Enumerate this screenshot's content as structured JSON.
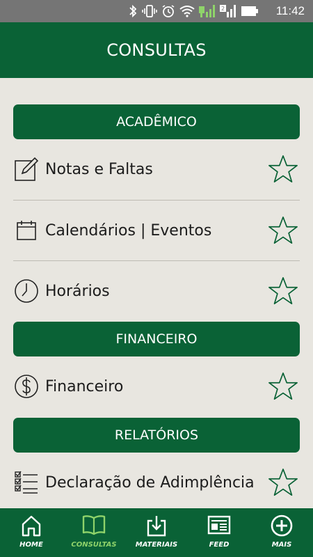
{
  "status_bar": {
    "time": "11:42",
    "icons": [
      "bluetooth-icon",
      "vibrate-icon",
      "alarm-icon",
      "wifi-icon",
      "signal-icon",
      "signal-2-icon",
      "battery-icon"
    ]
  },
  "header": {
    "title": "CONSULTAS"
  },
  "sections": [
    {
      "title": "ACADÊMICO",
      "items": [
        {
          "label": "Notas e Faltas",
          "icon": "edit-icon"
        },
        {
          "label": "Calendários | Eventos",
          "icon": "calendar-icon"
        },
        {
          "label": "Horários",
          "icon": "clock-icon"
        }
      ]
    },
    {
      "title": "FINANCEIRO",
      "items": [
        {
          "label": "Financeiro",
          "icon": "dollar-icon"
        }
      ]
    },
    {
      "title": "RELATÓRIOS",
      "items": [
        {
          "label": "Declaração de Adimplência",
          "icon": "checklist-icon"
        }
      ]
    }
  ],
  "bottom_nav": [
    {
      "label": "HOME",
      "icon": "home-icon",
      "active": false
    },
    {
      "label": "CONSULTAS",
      "icon": "book-icon",
      "active": true
    },
    {
      "label": "MATERIAIS",
      "icon": "download-icon",
      "active": false
    },
    {
      "label": "FEED",
      "icon": "news-icon",
      "active": false
    },
    {
      "label": "MAIS",
      "icon": "plus-circle-icon",
      "active": false
    }
  ],
  "colors": {
    "primary": "#0a6236",
    "background": "#e8e6e0",
    "nav_active": "#8fd36a",
    "status_bar": "#757575",
    "star_outline": "#0a6236"
  }
}
